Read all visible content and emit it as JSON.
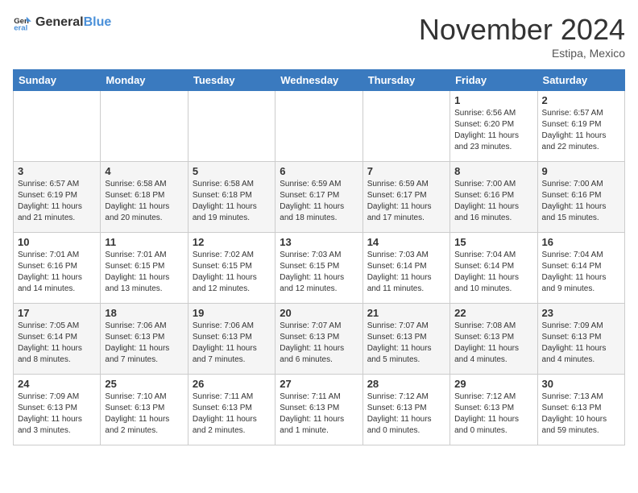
{
  "header": {
    "logo_general": "General",
    "logo_blue": "Blue",
    "month_title": "November 2024",
    "location": "Estipa, Mexico"
  },
  "weekdays": [
    "Sunday",
    "Monday",
    "Tuesday",
    "Wednesday",
    "Thursday",
    "Friday",
    "Saturday"
  ],
  "weeks": [
    [
      {
        "day": "",
        "info": ""
      },
      {
        "day": "",
        "info": ""
      },
      {
        "day": "",
        "info": ""
      },
      {
        "day": "",
        "info": ""
      },
      {
        "day": "",
        "info": ""
      },
      {
        "day": "1",
        "info": "Sunrise: 6:56 AM\nSunset: 6:20 PM\nDaylight: 11 hours and 23 minutes."
      },
      {
        "day": "2",
        "info": "Sunrise: 6:57 AM\nSunset: 6:19 PM\nDaylight: 11 hours and 22 minutes."
      }
    ],
    [
      {
        "day": "3",
        "info": "Sunrise: 6:57 AM\nSunset: 6:19 PM\nDaylight: 11 hours and 21 minutes."
      },
      {
        "day": "4",
        "info": "Sunrise: 6:58 AM\nSunset: 6:18 PM\nDaylight: 11 hours and 20 minutes."
      },
      {
        "day": "5",
        "info": "Sunrise: 6:58 AM\nSunset: 6:18 PM\nDaylight: 11 hours and 19 minutes."
      },
      {
        "day": "6",
        "info": "Sunrise: 6:59 AM\nSunset: 6:17 PM\nDaylight: 11 hours and 18 minutes."
      },
      {
        "day": "7",
        "info": "Sunrise: 6:59 AM\nSunset: 6:17 PM\nDaylight: 11 hours and 17 minutes."
      },
      {
        "day": "8",
        "info": "Sunrise: 7:00 AM\nSunset: 6:16 PM\nDaylight: 11 hours and 16 minutes."
      },
      {
        "day": "9",
        "info": "Sunrise: 7:00 AM\nSunset: 6:16 PM\nDaylight: 11 hours and 15 minutes."
      }
    ],
    [
      {
        "day": "10",
        "info": "Sunrise: 7:01 AM\nSunset: 6:16 PM\nDaylight: 11 hours and 14 minutes."
      },
      {
        "day": "11",
        "info": "Sunrise: 7:01 AM\nSunset: 6:15 PM\nDaylight: 11 hours and 13 minutes."
      },
      {
        "day": "12",
        "info": "Sunrise: 7:02 AM\nSunset: 6:15 PM\nDaylight: 11 hours and 12 minutes."
      },
      {
        "day": "13",
        "info": "Sunrise: 7:03 AM\nSunset: 6:15 PM\nDaylight: 11 hours and 12 minutes."
      },
      {
        "day": "14",
        "info": "Sunrise: 7:03 AM\nSunset: 6:14 PM\nDaylight: 11 hours and 11 minutes."
      },
      {
        "day": "15",
        "info": "Sunrise: 7:04 AM\nSunset: 6:14 PM\nDaylight: 11 hours and 10 minutes."
      },
      {
        "day": "16",
        "info": "Sunrise: 7:04 AM\nSunset: 6:14 PM\nDaylight: 11 hours and 9 minutes."
      }
    ],
    [
      {
        "day": "17",
        "info": "Sunrise: 7:05 AM\nSunset: 6:14 PM\nDaylight: 11 hours and 8 minutes."
      },
      {
        "day": "18",
        "info": "Sunrise: 7:06 AM\nSunset: 6:13 PM\nDaylight: 11 hours and 7 minutes."
      },
      {
        "day": "19",
        "info": "Sunrise: 7:06 AM\nSunset: 6:13 PM\nDaylight: 11 hours and 7 minutes."
      },
      {
        "day": "20",
        "info": "Sunrise: 7:07 AM\nSunset: 6:13 PM\nDaylight: 11 hours and 6 minutes."
      },
      {
        "day": "21",
        "info": "Sunrise: 7:07 AM\nSunset: 6:13 PM\nDaylight: 11 hours and 5 minutes."
      },
      {
        "day": "22",
        "info": "Sunrise: 7:08 AM\nSunset: 6:13 PM\nDaylight: 11 hours and 4 minutes."
      },
      {
        "day": "23",
        "info": "Sunrise: 7:09 AM\nSunset: 6:13 PM\nDaylight: 11 hours and 4 minutes."
      }
    ],
    [
      {
        "day": "24",
        "info": "Sunrise: 7:09 AM\nSunset: 6:13 PM\nDaylight: 11 hours and 3 minutes."
      },
      {
        "day": "25",
        "info": "Sunrise: 7:10 AM\nSunset: 6:13 PM\nDaylight: 11 hours and 2 minutes."
      },
      {
        "day": "26",
        "info": "Sunrise: 7:11 AM\nSunset: 6:13 PM\nDaylight: 11 hours and 2 minutes."
      },
      {
        "day": "27",
        "info": "Sunrise: 7:11 AM\nSunset: 6:13 PM\nDaylight: 11 hours and 1 minute."
      },
      {
        "day": "28",
        "info": "Sunrise: 7:12 AM\nSunset: 6:13 PM\nDaylight: 11 hours and 0 minutes."
      },
      {
        "day": "29",
        "info": "Sunrise: 7:12 AM\nSunset: 6:13 PM\nDaylight: 11 hours and 0 minutes."
      },
      {
        "day": "30",
        "info": "Sunrise: 7:13 AM\nSunset: 6:13 PM\nDaylight: 10 hours and 59 minutes."
      }
    ]
  ]
}
